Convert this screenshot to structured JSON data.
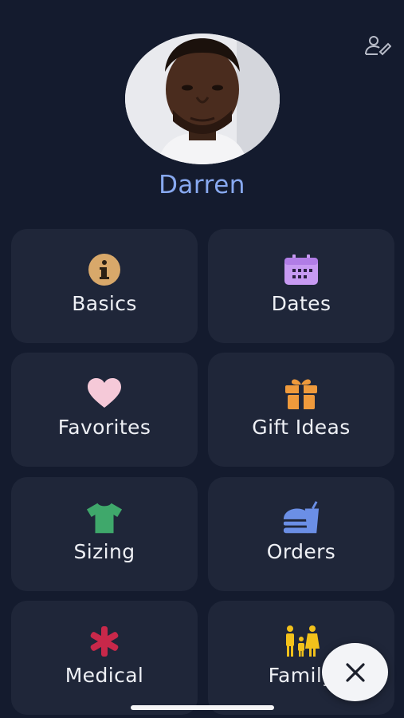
{
  "profile": {
    "name": "Darren",
    "avatar_icon": "profile-photo",
    "edit_icon": "user-edit-icon"
  },
  "tiles": [
    {
      "label": "Basics",
      "icon": "info-icon",
      "color": "#d8a86a"
    },
    {
      "label": "Dates",
      "icon": "calendar-icon",
      "color": "#c79af2"
    },
    {
      "label": "Favorites",
      "icon": "heart-icon",
      "color": "#f5c9d8"
    },
    {
      "label": "Gift Ideas",
      "icon": "gift-icon",
      "color": "#ef9a3c"
    },
    {
      "label": "Sizing",
      "icon": "shirt-icon",
      "color": "#3fa86b"
    },
    {
      "label": "Orders",
      "icon": "fastfood-icon",
      "color": "#6b8fe6"
    },
    {
      "label": "Medical",
      "icon": "asterisk-icon",
      "color": "#c8284a"
    },
    {
      "label": "Family",
      "icon": "family-icon",
      "color": "#f2c11b"
    }
  ],
  "fab": {
    "icon": "close-icon"
  },
  "colors": {
    "background": "#141b2e",
    "tile": "#1f2639",
    "name": "#88a9f0",
    "label": "#eef0f5"
  }
}
